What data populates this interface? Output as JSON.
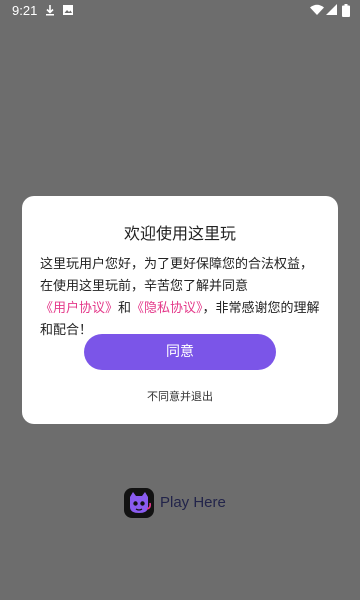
{
  "status_bar": {
    "time": "9:21",
    "icons": [
      "download-icon",
      "image-icon",
      "wifi-icon",
      "signal-icon",
      "battery-icon"
    ]
  },
  "dialog": {
    "title": "欢迎使用这里玩",
    "body_prefix": "这里玩用户您好，为了更好保障您的合法权益，在使用这里玩前，辛苦您了解并同意",
    "link_user_agreement": "《用户协议》",
    "conjunction": "和",
    "link_privacy_agreement": "《隐私协议》",
    "body_suffix": "，非常感谢您的理解和配合！",
    "agree_button": "同意",
    "disagree_link": "不同意并退出"
  },
  "brand": {
    "name": "Play Here",
    "logo_icon": "play-here-logo-icon"
  },
  "colors": {
    "overlay": "#6d6d6d",
    "accent": "#7b55e8",
    "link": "#e4398a",
    "brand_text": "#22244a"
  }
}
